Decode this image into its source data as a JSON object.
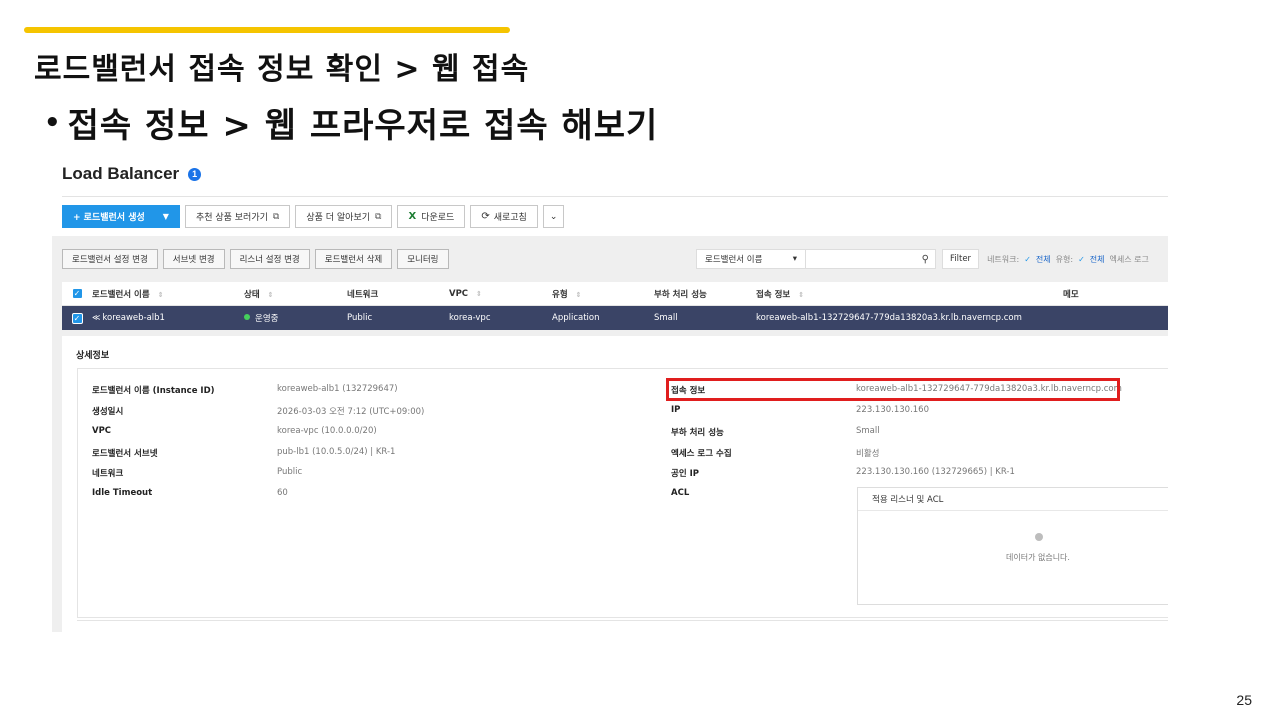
{
  "slide": {
    "title": "로드밸런서 접속 정보 확인 > 웹 접속",
    "bullet": "접속 정보 > 웹 프라우저로 접속 해보기",
    "page_number": "25",
    "accent_color": "#f5c400"
  },
  "console": {
    "header": {
      "title": "Load Balancer",
      "badge": "1"
    },
    "toolbar": {
      "create": "+ 로드밸런서 생성",
      "recommend": "추천 상품 보러가기",
      "learn_more": "상품 더 알아보기",
      "download": "다운로드",
      "refresh": "새로고침"
    },
    "actions": [
      "로드밸런서 설정 변경",
      "서브넷 변경",
      "리스너 설정 변경",
      "로드밸런서 삭제",
      "모니터링"
    ],
    "filter": {
      "select": "로드밸런서 이름",
      "button": "Filter",
      "network_label": "네트워크:",
      "network_value": "전체",
      "type_label": "유형:",
      "type_value": "전체",
      "access_log": "엑세스 로그"
    },
    "table": {
      "headers": {
        "name": "로드밸런서 이름",
        "state": "상태",
        "network": "네트워크",
        "vpc": "VPC",
        "type": "유형",
        "performance": "부하 처리 성능",
        "connection": "접속 정보",
        "memo": "메모"
      },
      "row": {
        "name": "koreaweb-alb1",
        "state": "운영중",
        "network": "Public",
        "vpc": "korea-vpc",
        "type": "Application",
        "performance": "Small",
        "connection": "koreaweb-alb1-132729647-779da13820a3.kr.lb.naverncp.com"
      }
    },
    "detail": {
      "title": "상세정보",
      "left": [
        {
          "key": "로드밸런서 이름 (Instance ID)",
          "value": "koreaweb-alb1 (132729647)"
        },
        {
          "key": "생성일시",
          "value": "2026-03-03 오전 7:12 (UTC+09:00)"
        },
        {
          "key": "VPC",
          "value": "korea-vpc (10.0.0.0/20)"
        },
        {
          "key": "로드밸런서 서브넷",
          "value": "pub-lb1 (10.0.5.0/24) | KR-1"
        },
        {
          "key": "네트워크",
          "value": "Public"
        },
        {
          "key": "Idle Timeout",
          "value": "60"
        }
      ],
      "right": [
        {
          "key": "접속 정보",
          "value": "koreaweb-alb1-132729647-779da13820a3.kr.lb.naverncp.com"
        },
        {
          "key": "IP",
          "value": "223.130.130.160"
        },
        {
          "key": "부하 처리 성능",
          "value": "Small"
        },
        {
          "key": "엑세스 로그 수집",
          "value": "비활성"
        },
        {
          "key": "공인 IP",
          "value": "223.130.130.160 (132729665) | KR-1"
        },
        {
          "key": "ACL",
          "value": ""
        }
      ],
      "acl": {
        "title": "적용 리스너 및 ACL",
        "empty": "데이터가 없습니다."
      }
    }
  }
}
